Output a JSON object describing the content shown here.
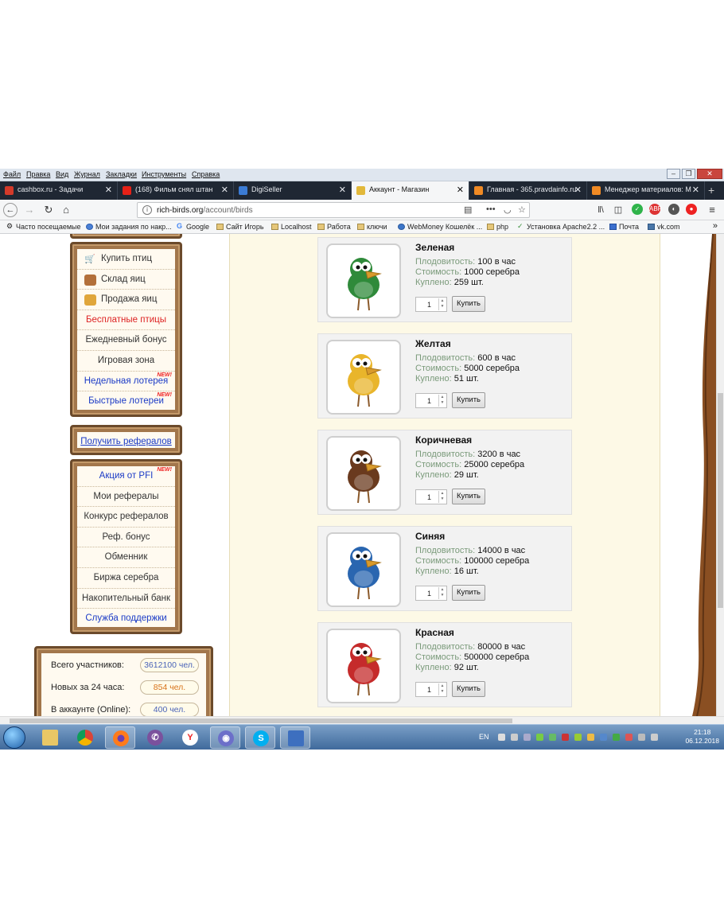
{
  "menubar": [
    "Файл",
    "Правка",
    "Вид",
    "Журнал",
    "Закладки",
    "Инструменты",
    "Справка"
  ],
  "tabs": [
    {
      "label": "cashbox.ru - Задачи",
      "color": "#d43a2a"
    },
    {
      "label": "(168) Фильм снял штан",
      "color": "#e62117"
    },
    {
      "label": "DigiSeller",
      "color": "#3b7bd4"
    },
    {
      "label": "Аккаунт - Магазин",
      "color": "#e2b83a"
    },
    {
      "label": "Главная - 365.pravdainfo.ru",
      "color": "#f08a24"
    },
    {
      "label": "Менеджер материалов: М",
      "color": "#f08a24"
    }
  ],
  "nav": {
    "url_prefix": "rich-birds.org",
    "url_path": "/account/birds"
  },
  "bookmarks": [
    "Часто посещаемые",
    "Мои задания по накр...",
    "Google",
    "Сайт Игорь",
    "Localhost",
    "Работа",
    "ключи",
    "WebMoney Кошелёк ...",
    "php",
    "Установка Apache2.2 ...",
    "Почта",
    "vk.com"
  ],
  "sidebar": {
    "menu1": [
      {
        "label": "Купить птиц",
        "style": "left",
        "icon": "cart-icon"
      },
      {
        "label": "Склад яиц",
        "style": "left",
        "icon": "warehouse-icon"
      },
      {
        "label": "Продажа яиц",
        "style": "left",
        "icon": "eggs-sale-icon"
      },
      {
        "label": "Бесплатные птицы",
        "style": "red"
      },
      {
        "label": "Ежедневный бонус",
        "style": ""
      },
      {
        "label": "Игровая зона",
        "style": ""
      },
      {
        "label": "Недельная лотерея",
        "style": "blue",
        "badge": "NEW!"
      },
      {
        "label": "Быстрые лотереи",
        "style": "blue",
        "badge": "NEW!"
      }
    ],
    "ref_link": "Получить рефералов",
    "menu2": [
      {
        "label": "Акция от PFI",
        "style": "blue",
        "badge": "NEW!"
      },
      {
        "label": "Мои рефералы",
        "style": ""
      },
      {
        "label": "Конкурс рефералов",
        "style": ""
      },
      {
        "label": "Реф. бонус",
        "style": ""
      },
      {
        "label": "Обменник",
        "style": ""
      },
      {
        "label": "Биржа серебра",
        "style": ""
      },
      {
        "label": "Накопительный банк",
        "style": ""
      },
      {
        "label": "Служба поддержки",
        "style": "blue"
      }
    ],
    "stats": [
      {
        "label": "Всего участников:",
        "value": "3612100 чел.",
        "color": "#4a63b8"
      },
      {
        "label": "Новых за 24 часа:",
        "value": "854 чел.",
        "color": "#d8731a"
      },
      {
        "label": "В аккаунте (Online):",
        "value": "400 чел.",
        "color": "#4a63b8"
      }
    ]
  },
  "labels": {
    "fertility": "Плодовитость:",
    "cost": "Стоимость:",
    "bought": "Куплено:",
    "buy": "Купить"
  },
  "birds": [
    {
      "name": "Зеленая",
      "fertility": "100 в час",
      "cost": "1000 серебра",
      "bought": "259 шт.",
      "qty": "1",
      "color": "#2f8a3a"
    },
    {
      "name": "Желтая",
      "fertility": "600 в час",
      "cost": "5000 серебра",
      "bought": "51 шт.",
      "qty": "1",
      "color": "#e9b52b"
    },
    {
      "name": "Коричневая",
      "fertility": "3200 в час",
      "cost": "25000 серебра",
      "bought": "29 шт.",
      "qty": "1",
      "color": "#6a3a1e"
    },
    {
      "name": "Синяя",
      "fertility": "14000 в час",
      "cost": "100000 серебра",
      "bought": "16 шт.",
      "qty": "1",
      "color": "#2a66b0"
    },
    {
      "name": "Красная",
      "fertility": "80000 в час",
      "cost": "500000 серебра",
      "bought": "92 шт.",
      "qty": "1",
      "color": "#c52b2b"
    }
  ],
  "taskbar": {
    "lang": "EN",
    "time": "21:18",
    "date": "06.12.2018"
  }
}
